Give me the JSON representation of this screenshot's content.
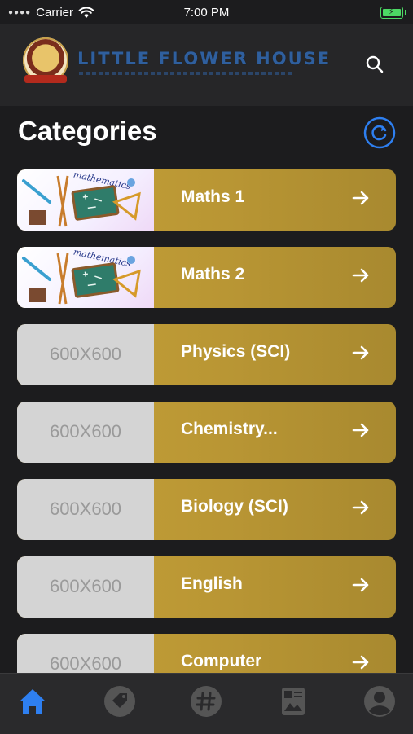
{
  "status_bar": {
    "carrier": "Carrier",
    "time": "7:00 PM"
  },
  "header": {
    "brand_name": "LITTLE FLOWER HOUSE"
  },
  "page": {
    "title": "Categories"
  },
  "categories": [
    {
      "label": "Maths 1",
      "thumbnail": "mathematics"
    },
    {
      "label": "Maths 2",
      "thumbnail": "mathematics"
    },
    {
      "label": "Physics (SCI)",
      "thumbnail": "600X600"
    },
    {
      "label": "Chemistry...",
      "thumbnail": "600X600"
    },
    {
      "label": "Biology (SCI)",
      "thumbnail": "600X600"
    },
    {
      "label": "English",
      "thumbnail": "600X600"
    },
    {
      "label": "Computer",
      "thumbnail": "600X600"
    }
  ],
  "math_thumb_text": "mathematics",
  "tab_bar": [
    "home-icon",
    "tag-icon",
    "hashtag-icon",
    "article-icon",
    "profile-icon"
  ],
  "colors": {
    "background": "#1c1c1e",
    "card_gold": "#c6a138",
    "accent_blue": "#2e7ff0",
    "brand_blue": "#2f5f9e"
  }
}
